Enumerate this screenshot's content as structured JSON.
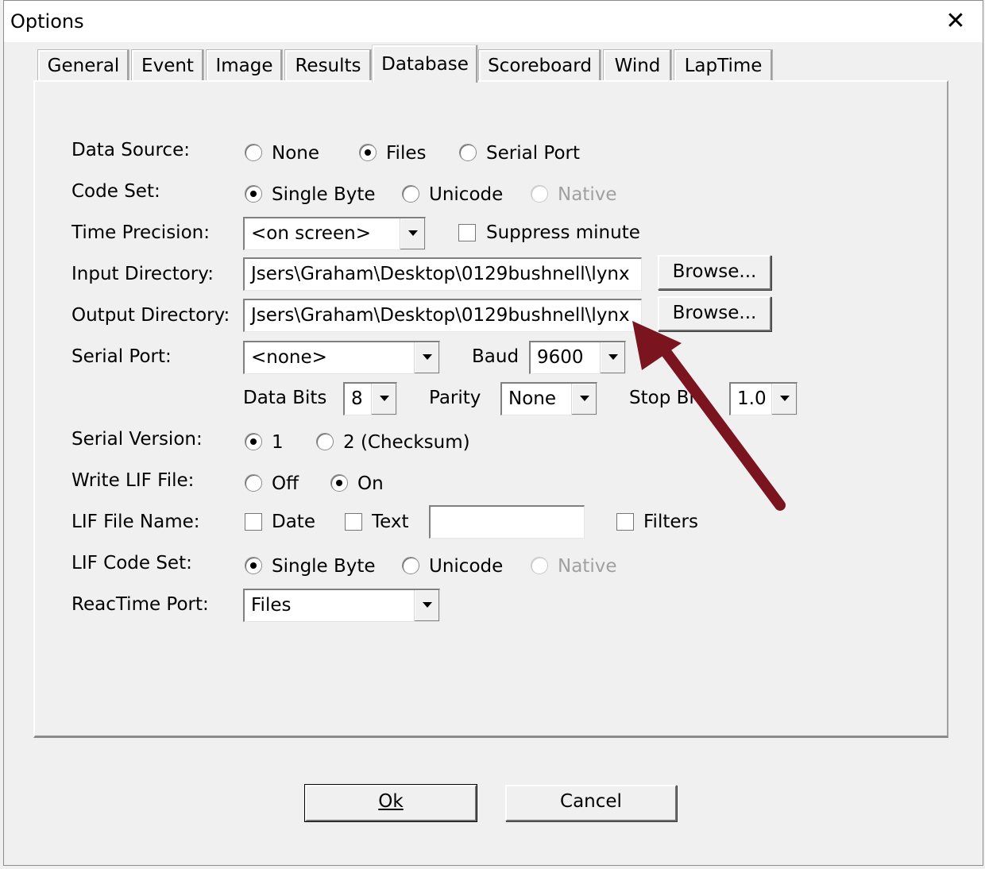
{
  "window": {
    "title": "Options",
    "close_glyph": "✕"
  },
  "tabs": [
    {
      "label": "General"
    },
    {
      "label": "Event"
    },
    {
      "label": "Image"
    },
    {
      "label": "Results"
    },
    {
      "label": "Database",
      "active": true
    },
    {
      "label": "Scoreboard"
    },
    {
      "label": "Wind"
    },
    {
      "label": "LapTime"
    }
  ],
  "form": {
    "data_source": {
      "label": "Data Source:",
      "options": [
        "None",
        "Files",
        "Serial Port"
      ],
      "selected": "Files"
    },
    "code_set": {
      "label": "Code Set:",
      "options": [
        "Single Byte",
        "Unicode",
        "Native"
      ],
      "selected": "Single Byte",
      "disabled": [
        "Native"
      ]
    },
    "time_precision": {
      "label": "Time Precision:",
      "value": "<on screen>",
      "suppress_label": "Suppress minute",
      "suppress_checked": false
    },
    "input_directory": {
      "label": "Input Directory:",
      "value": "Jsers\\Graham\\Desktop\\0129bushnell\\lynx",
      "browse": "Browse..."
    },
    "output_directory": {
      "label": "Output Directory:",
      "value": "Jsers\\Graham\\Desktop\\0129bushnell\\lynx",
      "browse": "Browse..."
    },
    "serial_port": {
      "label": "Serial Port:",
      "value": "<none>",
      "baud_label": "Baud",
      "baud_value": "9600"
    },
    "serial_settings": {
      "data_bits_label": "Data Bits",
      "data_bits_value": "8",
      "parity_label": "Parity",
      "parity_value": "None",
      "stop_bits_label": "Stop Bi",
      "stop_bits_value": "1.0"
    },
    "serial_version": {
      "label": "Serial Version:",
      "options": [
        "1",
        "2 (Checksum)"
      ],
      "selected": "1"
    },
    "write_lif": {
      "label": "Write LIF File:",
      "options": [
        "Off",
        "On"
      ],
      "selected": "On"
    },
    "lif_file_name": {
      "label": "LIF File Name:",
      "date_label": "Date",
      "text_label": "Text",
      "text_value": "",
      "filters_label": "Filters"
    },
    "lif_code_set": {
      "label": "LIF Code Set:",
      "options": [
        "Single Byte",
        "Unicode",
        "Native"
      ],
      "selected": "Single Byte",
      "disabled": [
        "Native"
      ]
    },
    "reactime_port": {
      "label": "ReacTime Port:",
      "value": "Files"
    }
  },
  "buttons": {
    "ok": "Ok",
    "cancel": "Cancel"
  },
  "colors": {
    "arrow": "#7a1520",
    "background": "#f0f0f0"
  }
}
